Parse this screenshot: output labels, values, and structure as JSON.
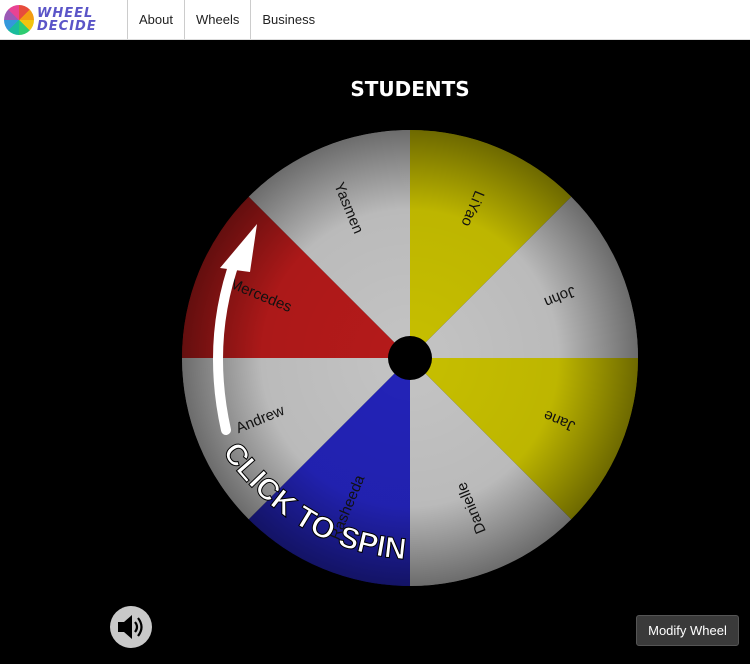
{
  "app": {
    "logo_text_line1": "WHEEL",
    "logo_text_line2": "DECIDE"
  },
  "nav": {
    "items": [
      {
        "label": "About"
      },
      {
        "label": "Wheels"
      },
      {
        "label": "Business"
      }
    ]
  },
  "wheel": {
    "title": "STUDENTS",
    "spin_label": "CLICK TO SPIN",
    "segments": [
      {
        "name": "LiYao",
        "color": "#c7bf00"
      },
      {
        "name": "John",
        "color": "#c4c4c4"
      },
      {
        "name": "Jane",
        "color": "#c7bf00"
      },
      {
        "name": "Danielle",
        "color": "#c4c4c4"
      },
      {
        "name": "Rasheeda",
        "color": "#2323b8"
      },
      {
        "name": "Andrew",
        "color": "#c4c4c4"
      },
      {
        "name": "Mercedes",
        "color": "#b51a1a"
      },
      {
        "name": "Yasmen",
        "color": "#c4c4c4"
      }
    ]
  },
  "controls": {
    "modify_label": "Modify Wheel",
    "sound_icon": "speaker-icon"
  }
}
